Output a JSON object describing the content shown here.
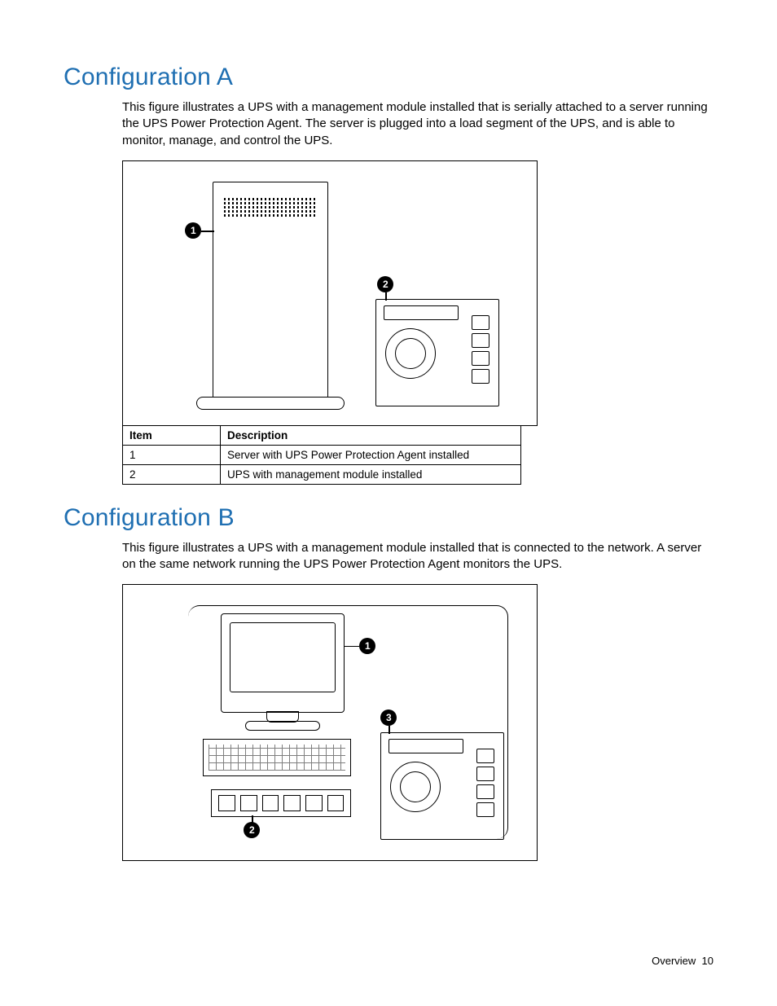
{
  "sectionA": {
    "title": "Configuration A",
    "paragraph": "This figure illustrates a UPS with a management module installed that is serially attached to a server running the UPS Power Protection Agent. The server is plugged into a load segment of the UPS, and is able to monitor, manage, and control the UPS.",
    "callouts": {
      "c1": "1",
      "c2": "2"
    },
    "table": {
      "head_item": "Item",
      "head_desc": "Description",
      "rows": [
        {
          "item": "1",
          "desc": "Server with UPS Power Protection Agent installed"
        },
        {
          "item": "2",
          "desc": "UPS with management module installed"
        }
      ]
    }
  },
  "sectionB": {
    "title": "Configuration B",
    "paragraph": "This figure illustrates a UPS with a management module installed that is connected to the network. A server on the same network running the UPS Power Protection Agent monitors the UPS.",
    "callouts": {
      "c1": "1",
      "c2": "2",
      "c3": "3"
    }
  },
  "footer": {
    "section": "Overview",
    "page": "10"
  }
}
